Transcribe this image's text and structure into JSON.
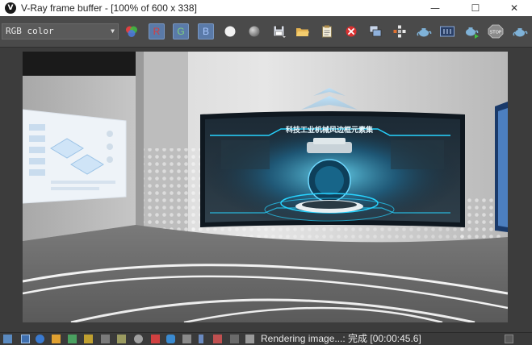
{
  "window": {
    "title": "V-Ray frame buffer - [100% of 600 x 338]",
    "app_icon_glyph": "V",
    "minimize_glyph": "—",
    "maximize_glyph": "☐",
    "close_glyph": "✕"
  },
  "toolbar": {
    "channel_value": "RGB color",
    "red_label": "R",
    "green_label": "G",
    "blue_label": "B"
  },
  "render": {
    "banner_text": "科技工业机械风边框元素集"
  },
  "status": {
    "text": "Rendering image...: 完成 [00:00:45.6]"
  },
  "colors": {
    "red_channel": "#d93c3c",
    "green_channel": "#7fd07f",
    "blue_channel": "#7aa8f0",
    "accent_cyan": "#27d3ff"
  }
}
